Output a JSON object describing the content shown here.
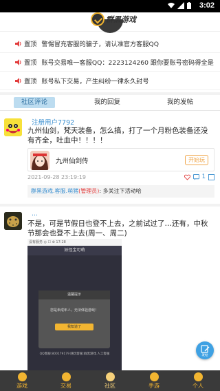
{
  "status_bar": {
    "time": "3:02"
  },
  "header": {
    "logo_text": "群黑游戏"
  },
  "notices": [
    {
      "tag": "置顶",
      "text": "警惕冒充客服的骗子，请认准官方客服QQ"
    },
    {
      "tag": "置顶",
      "text": "账号交易唯一客服QQ：2223124260 跟你要账号密码得全是"
    },
    {
      "tag": "置顶",
      "text": "账号私下交易，产生纠纷一律永久封号"
    }
  ],
  "tabs": [
    {
      "label": "社区评论",
      "active": true
    },
    {
      "label": "我的回复",
      "active": false
    },
    {
      "label": "我的发帖",
      "active": false
    }
  ],
  "post1": {
    "username": "注册用户7792",
    "text": "九州仙剑，梵天装备，怎么搞，打了一个月粉色装备还没有齐全，吐血中！！！！",
    "game": {
      "name": "九州仙剑传",
      "button": "开始玩"
    },
    "time": "2021-09-28 23:19:19",
    "comments": "1",
    "reply": {
      "who": "群黑游戏.客服.萌猪",
      "role": "(管理员)",
      "text": ": 多关注下活动哈"
    }
  },
  "post2": {
    "username": "...",
    "text": "不是，可是节假日也登不上去，之前试过了…还有，中秋节那会也登不上去(周一、周二)",
    "screenshot": {
      "top_bar": "没有服务 ◎ ☐ ⊕ 17:28",
      "title": "妖怪宝可萌",
      "dialog_title": "温馨提示",
      "dialog_msg": "您是未成年人，无法体验游戏！",
      "dialog_btn": "我知道了",
      "footer": "QQ客服:800179179 随玩客服:群黑游戏.人工客服"
    }
  },
  "fab": {
    "label": "发帖"
  },
  "bottom_nav": [
    {
      "label": "游戏",
      "active": false
    },
    {
      "label": "交易",
      "active": false
    },
    {
      "label": "社区",
      "active": true
    },
    {
      "label": "手游",
      "active": false
    },
    {
      "label": "个人",
      "active": false
    }
  ],
  "colors": {
    "accent": "#3a8fd0",
    "tab_active_bg": "#bcdcf0",
    "nav_bg": "#3a3a3a",
    "nav_icon": "#f2b531",
    "speaker": "#e23b3b"
  }
}
